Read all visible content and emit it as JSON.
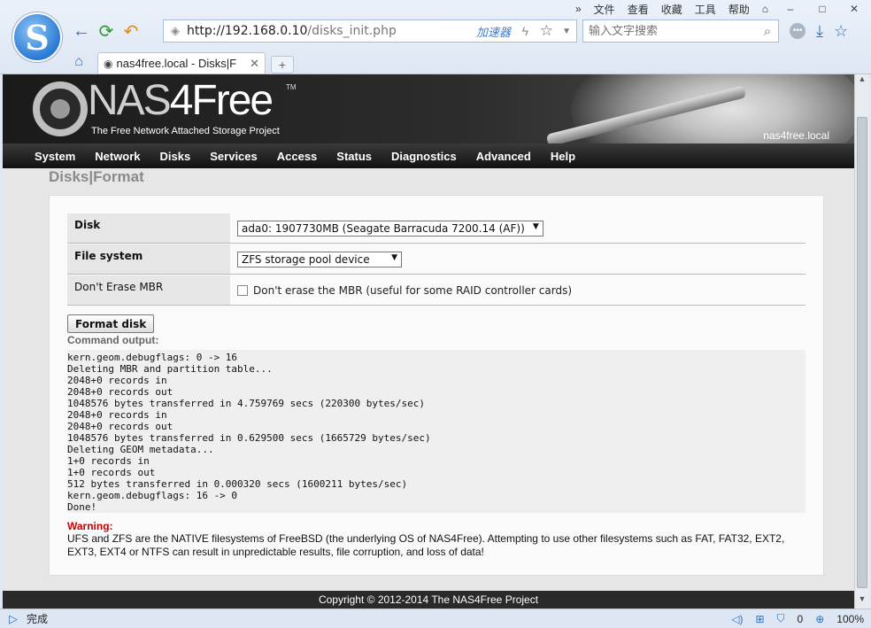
{
  "browser": {
    "menu": [
      "文件",
      "查看",
      "收藏",
      "工具",
      "帮助"
    ],
    "url_host": "http://192.168.0.10",
    "url_path": "/disks_init.php",
    "accelerator": "加速器",
    "search_placeholder": "输入文字搜索",
    "tab_title": "nas4free.local - Disks|F",
    "status": "完成",
    "blocked_count": "0",
    "zoom": "100%"
  },
  "banner": {
    "brand_gray": "NAS",
    "brand_white": "4Free",
    "tm": "TM",
    "tagline": "The Free Network Attached Storage Project",
    "hostname": "nas4free.local"
  },
  "nav": [
    "System",
    "Network",
    "Disks",
    "Services",
    "Access",
    "Status",
    "Diagnostics",
    "Advanced",
    "Help"
  ],
  "page": {
    "title_1": "Disks",
    "separator": "|",
    "title_2": "Format"
  },
  "form": {
    "disk_label": "Disk",
    "disk_value": "ada0: 1907730MB (Seagate Barracuda 7200.14 (AF))",
    "fs_label": "File system",
    "fs_value": "ZFS storage pool device",
    "mbr_label": "Don't Erase MBR",
    "mbr_checkbox_text": "Don't erase the MBR (useful for some RAID controller cards)",
    "format_button": "Format disk",
    "output_label": "Command output:"
  },
  "output_lines": "kern.geom.debugflags: 0 -> 16\nDeleting MBR and partition table...\n2048+0 records in\n2048+0 records out\n1048576 bytes transferred in 4.759769 secs (220300 bytes/sec)\n2048+0 records in\n2048+0 records out\n1048576 bytes transferred in 0.629500 secs (1665729 bytes/sec)\nDeleting GEOM metadata...\n1+0 records in\n1+0 records out\n512 bytes transferred in 0.000320 secs (1600211 bytes/sec)\nkern.geom.debugflags: 16 -> 0\nDone!",
  "warning": {
    "head": "Warning:",
    "text": "UFS and ZFS are the NATIVE filesystems of FreeBSD (the underlying OS of NAS4Free). Attempting to use other filesystems such as FAT, FAT32, EXT2, EXT3, EXT4 or NTFS can result in unpredictable results, file corruption, and loss of data!"
  },
  "footer": "Copyright © 2012-2014 The NAS4Free Project"
}
